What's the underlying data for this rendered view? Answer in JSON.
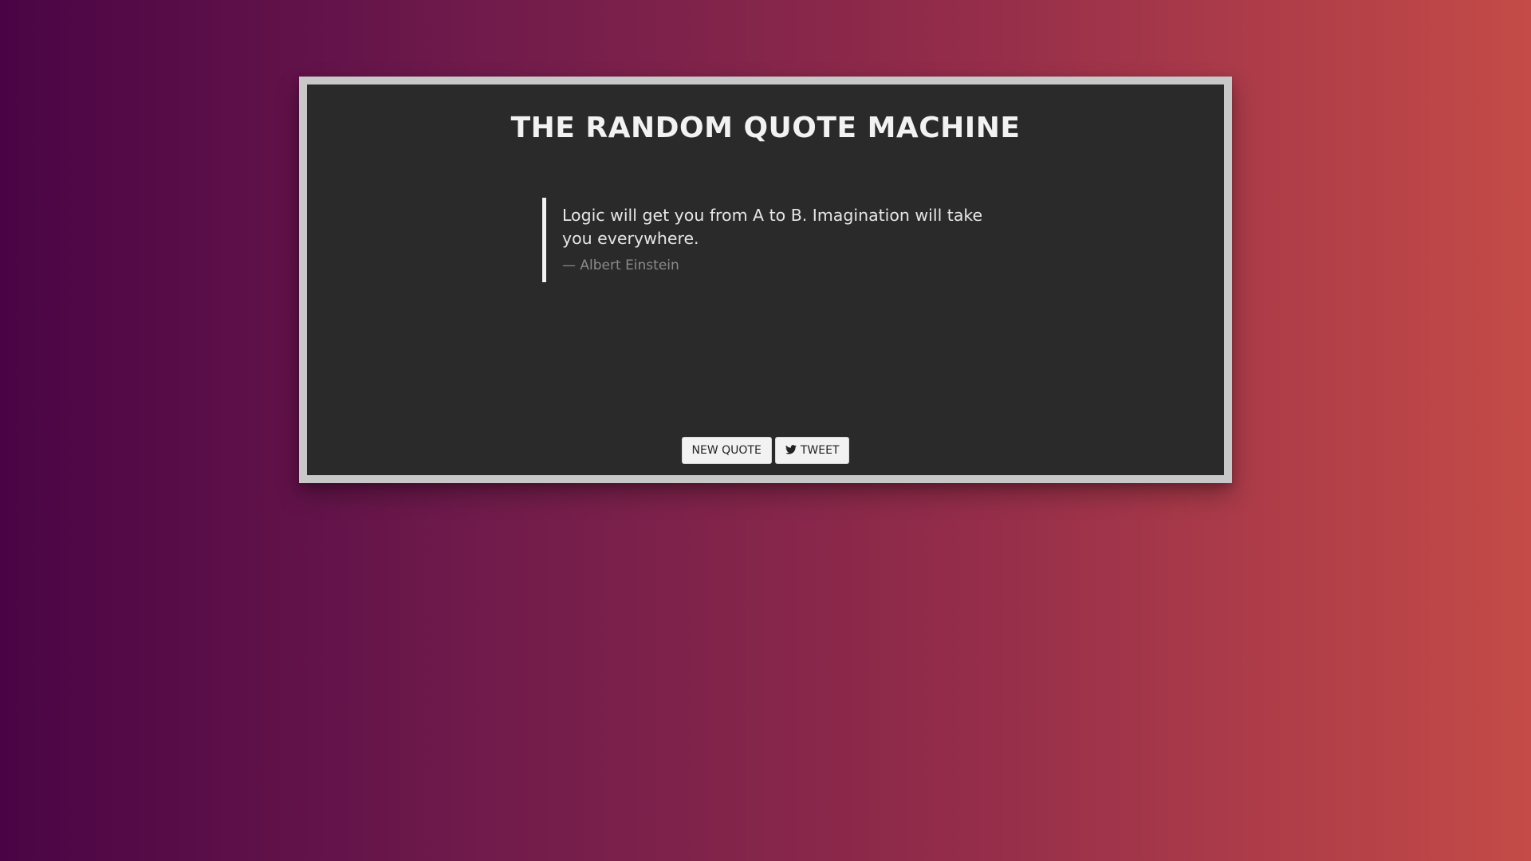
{
  "app": {
    "title": "THE RANDOM QUOTE MACHINE"
  },
  "quote": {
    "text": "Logic will get you from A to B. Imagination will take you everywhere.",
    "author": "— Albert Einstein"
  },
  "buttons": {
    "new_quote_label": "NEW QUOTE",
    "tweet_label": "TWEET",
    "tweet_icon": "twitter-bird-icon"
  },
  "colors": {
    "background_start": "#4a0445",
    "background_end": "#c44b47",
    "panel": "#2a2a2a",
    "frame": "#c8c8c8",
    "button": "#f2f2f2"
  }
}
